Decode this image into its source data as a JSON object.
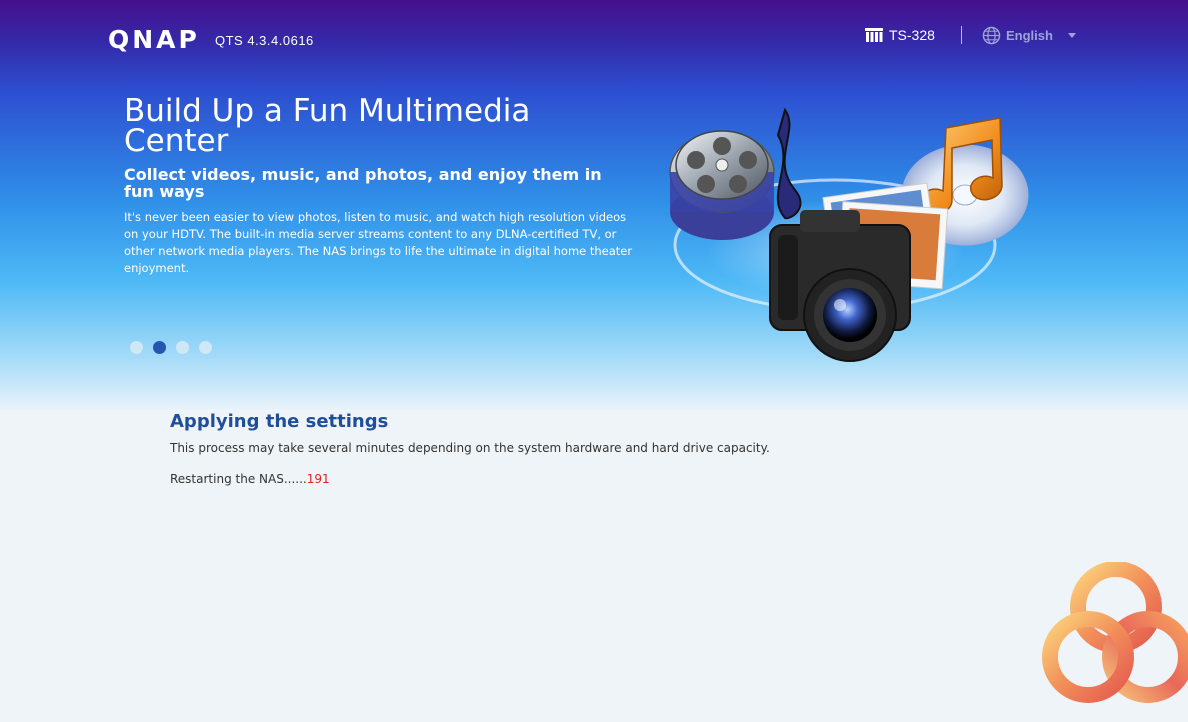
{
  "header": {
    "brand": "QNAP",
    "version": "QTS 4.3.4.0616",
    "model": "TS-328",
    "language": "English"
  },
  "hero": {
    "headline": "Build Up a Fun Multimedia Center",
    "subheadline": "Collect videos, music, and photos, and enjoy them in fun ways",
    "description": "It's never been easier to view photos, listen to music, and watch high resolution videos on your HDTV. The built-in media server streams content to any DLNA-certified TV, or other network media players. The NAS brings to life the ultimate in digital home theater enjoyment.",
    "slides": {
      "count": 4,
      "active_index": 1
    },
    "illustration": [
      "film-reel-icon",
      "music-disc-icon",
      "photos-icon",
      "camera-icon"
    ]
  },
  "status": {
    "title": "Applying the settings",
    "message": "This process may take several minutes depending on the system hardware and hard drive capacity.",
    "progress_label": "Restarting the NAS......",
    "countdown": "191",
    "countdown_color": "#e02020"
  },
  "colors": {
    "title": "#1f4f9a",
    "active_dot": "#2456b0"
  }
}
